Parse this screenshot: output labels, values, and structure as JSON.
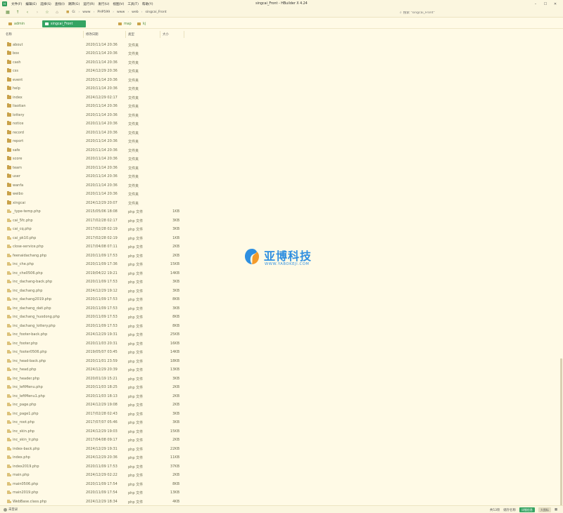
{
  "window": {
    "title": "singcai_Front - HBuilder X 4.24",
    "app_icon": "H"
  },
  "menu": [
    "文件(F)",
    "编辑(E)",
    "选择(S)",
    "查找(I)",
    "跳转(G)",
    "运行(R)",
    "发行(U)",
    "视图(V)",
    "工具(T)",
    "帮助(Y)"
  ],
  "breadcrumb": [
    "G:",
    "www",
    "PHP599",
    "www",
    "web",
    "singcai_Front"
  ],
  "search": {
    "placeholder": "搜索 \"singcai_Front\""
  },
  "tabs": [
    {
      "label": "admin"
    },
    {
      "label": "singcai_Front"
    },
    {
      "label": "map"
    },
    {
      "label": "kj"
    }
  ],
  "columns": {
    "name": "名称",
    "date": "修改日期",
    "type": "类型",
    "size": "大小"
  },
  "files": [
    {
      "name": "about",
      "date": "2020/11/14 20:36",
      "type": "文件夹",
      "size": "",
      "kind": "folder"
    },
    {
      "name": "box",
      "date": "2020/11/14 20:36",
      "type": "文件夹",
      "size": "",
      "kind": "folder"
    },
    {
      "name": "cash",
      "date": "2020/11/14 20:36",
      "type": "文件夹",
      "size": "",
      "kind": "folder"
    },
    {
      "name": "css",
      "date": "2024/12/29 20:36",
      "type": "文件夹",
      "size": "",
      "kind": "folder"
    },
    {
      "name": "event",
      "date": "2020/11/14 20:36",
      "type": "文件夹",
      "size": "",
      "kind": "folder"
    },
    {
      "name": "help",
      "date": "2020/11/14 20:36",
      "type": "文件夹",
      "size": "",
      "kind": "folder"
    },
    {
      "name": "index",
      "date": "2024/12/29 02:17",
      "type": "文件夹",
      "size": "",
      "kind": "folder"
    },
    {
      "name": "liaotian",
      "date": "2020/11/14 20:36",
      "type": "文件夹",
      "size": "",
      "kind": "folder"
    },
    {
      "name": "lottery",
      "date": "2020/11/14 20:36",
      "type": "文件夹",
      "size": "",
      "kind": "folder"
    },
    {
      "name": "notice",
      "date": "2020/11/14 20:36",
      "type": "文件夹",
      "size": "",
      "kind": "folder"
    },
    {
      "name": "record",
      "date": "2020/11/14 20:36",
      "type": "文件夹",
      "size": "",
      "kind": "folder"
    },
    {
      "name": "report",
      "date": "2020/11/14 20:36",
      "type": "文件夹",
      "size": "",
      "kind": "folder"
    },
    {
      "name": "safe",
      "date": "2020/11/14 20:36",
      "type": "文件夹",
      "size": "",
      "kind": "folder"
    },
    {
      "name": "score",
      "date": "2020/11/14 20:36",
      "type": "文件夹",
      "size": "",
      "kind": "folder"
    },
    {
      "name": "team",
      "date": "2020/11/14 20:36",
      "type": "文件夹",
      "size": "",
      "kind": "folder"
    },
    {
      "name": "user",
      "date": "2020/11/14 20:36",
      "type": "文件夹",
      "size": "",
      "kind": "folder"
    },
    {
      "name": "wanfa",
      "date": "2020/11/14 20:36",
      "type": "文件夹",
      "size": "",
      "kind": "folder"
    },
    {
      "name": "weibo",
      "date": "2020/11/14 20:36",
      "type": "文件夹",
      "size": "",
      "kind": "folder"
    },
    {
      "name": "xingcai",
      "date": "2024/12/29 20:07",
      "type": "文件夹",
      "size": "",
      "kind": "folder"
    },
    {
      "name": "_type-temp.php",
      "date": "2015/05/06 18:08",
      "type": "php 文件",
      "size": "1KB",
      "kind": "php"
    },
    {
      "name": "cai_5fc.php",
      "date": "2017/02/28 02:17",
      "type": "php 文件",
      "size": "3KB",
      "kind": "php"
    },
    {
      "name": "cai_cq.php",
      "date": "2017/02/28 02:19",
      "type": "php 文件",
      "size": "3KB",
      "kind": "php"
    },
    {
      "name": "cai_pk10.php",
      "date": "2017/02/28 02:19",
      "type": "php 文件",
      "size": "1KB",
      "kind": "php"
    },
    {
      "name": "close-service.php",
      "date": "2017/04/08 07:11",
      "type": "php 文件",
      "size": "2KB",
      "kind": "php"
    },
    {
      "name": "feenaidachang.php",
      "date": "2020/11/09 17:53",
      "type": "php 文件",
      "size": "2KB",
      "kind": "php"
    },
    {
      "name": "inc_che.php",
      "date": "2020/11/09 17:36",
      "type": "php 文件",
      "size": "15KB",
      "kind": "php"
    },
    {
      "name": "inc_che0506.php",
      "date": "2019/04/22 19:21",
      "type": "php 文件",
      "size": "14KB",
      "kind": "php"
    },
    {
      "name": "inc_dachang-back.php",
      "date": "2020/11/09 17:53",
      "type": "php 文件",
      "size": "3KB",
      "kind": "php"
    },
    {
      "name": "inc_dachang.php",
      "date": "2024/12/29 19:12",
      "type": "php 文件",
      "size": "3KB",
      "kind": "php"
    },
    {
      "name": "inc_dachang2019.php",
      "date": "2020/11/09 17:53",
      "type": "php 文件",
      "size": "8KB",
      "kind": "php"
    },
    {
      "name": "inc_dachang_dati.php",
      "date": "2020/11/09 17:53",
      "type": "php 文件",
      "size": "3KB",
      "kind": "php"
    },
    {
      "name": "inc_dachang_huodong.php",
      "date": "2020/11/09 17:53",
      "type": "php 文件",
      "size": "8KB",
      "kind": "php"
    },
    {
      "name": "inc_dachang_lottery.php",
      "date": "2020/11/09 17:53",
      "type": "php 文件",
      "size": "8KB",
      "kind": "php"
    },
    {
      "name": "inc_footer-back.php",
      "date": "2024/12/29 19:31",
      "type": "php 文件",
      "size": "25KB",
      "kind": "php"
    },
    {
      "name": "inc_footer.php",
      "date": "2020/11/03 20:31",
      "type": "php 文件",
      "size": "16KB",
      "kind": "php"
    },
    {
      "name": "inc_footer0506.php",
      "date": "2019/05/07 03:45",
      "type": "php 文件",
      "size": "14KB",
      "kind": "php"
    },
    {
      "name": "inc_head-back.php",
      "date": "2020/11/01 23:59",
      "type": "php 文件",
      "size": "18KB",
      "kind": "php"
    },
    {
      "name": "inc_head.php",
      "date": "2024/12/29 20:39",
      "type": "php 文件",
      "size": "13KB",
      "kind": "php"
    },
    {
      "name": "inc_header.php",
      "date": "2020/01/19 15:21",
      "type": "php 文件",
      "size": "3KB",
      "kind": "php"
    },
    {
      "name": "inc_leftMenu.php",
      "date": "2020/11/03 18:25",
      "type": "php 文件",
      "size": "2KB",
      "kind": "php"
    },
    {
      "name": "inc_leftMenu1.php",
      "date": "2020/11/03 18:13",
      "type": "php 文件",
      "size": "2KB",
      "kind": "php"
    },
    {
      "name": "inc_page.php",
      "date": "2024/12/29 19:08",
      "type": "php 文件",
      "size": "2KB",
      "kind": "php"
    },
    {
      "name": "inc_page1.php",
      "date": "2017/02/28 02:43",
      "type": "php 文件",
      "size": "3KB",
      "kind": "php"
    },
    {
      "name": "inc_root.php",
      "date": "2017/07/07 05:46",
      "type": "php 文件",
      "size": "3KB",
      "kind": "php"
    },
    {
      "name": "inc_skin.php",
      "date": "2024/12/29 19:03",
      "type": "php 文件",
      "size": "15KB",
      "kind": "php"
    },
    {
      "name": "inc_skin_lr.php",
      "date": "2017/04/08 09:17",
      "type": "php 文件",
      "size": "2KB",
      "kind": "php"
    },
    {
      "name": "index-back.php",
      "date": "2024/12/29 19:31",
      "type": "php 文件",
      "size": "22KB",
      "kind": "php"
    },
    {
      "name": "index.php",
      "date": "2024/12/29 20:36",
      "type": "php 文件",
      "size": "11KB",
      "kind": "php"
    },
    {
      "name": "index2019.php",
      "date": "2020/11/09 17:53",
      "type": "php 文件",
      "size": "37KB",
      "kind": "php"
    },
    {
      "name": "main.php",
      "date": "2024/12/29 02:22",
      "type": "php 文件",
      "size": "2KB",
      "kind": "php"
    },
    {
      "name": "main0506.php",
      "date": "2020/11/09 17:54",
      "type": "php 文件",
      "size": "8KB",
      "kind": "php"
    },
    {
      "name": "main2019.php",
      "date": "2020/11/09 17:54",
      "type": "php 文件",
      "size": "13KB",
      "kind": "php"
    },
    {
      "name": "WebBase.class.php",
      "date": "2024/12/29 18:34",
      "type": "php 文件",
      "size": "4KB",
      "kind": "php"
    }
  ],
  "watermark": {
    "title": "亚博科技",
    "url": "WWW.YABOKEJI.COM"
  },
  "status": {
    "login": "未登录",
    "item_count": "共53项",
    "selected_info": "储存名称",
    "view_label": "详细信息",
    "icon_label": "大图标"
  },
  "colors": {
    "accent": "#35a463",
    "folder": "#c9a24a",
    "background": "#fffae6",
    "watermark": "#2f8fe0"
  }
}
